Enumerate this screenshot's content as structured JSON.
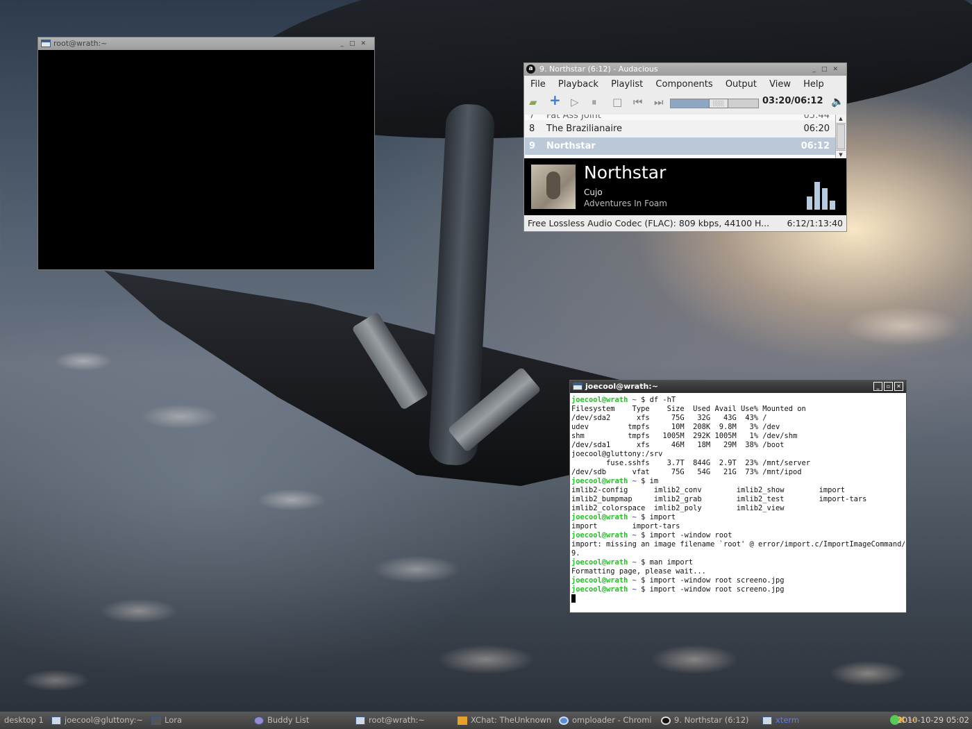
{
  "root_terminal": {
    "title": "root@wrath:~"
  },
  "audacious": {
    "title": "9. Northstar (6:12) - Audacious",
    "logo": "a",
    "menu": [
      "File",
      "Playback",
      "Playlist",
      "Components",
      "Output",
      "View",
      "Help"
    ],
    "time": "03:20/06:12",
    "seek_fraction": 0.54,
    "playlist": [
      {
        "num": "7",
        "title": "Fat Ass Joint",
        "duration": "05:44",
        "cut": true
      },
      {
        "num": "8",
        "title": "The Brazilianaire",
        "duration": "06:20"
      },
      {
        "num": "9",
        "title": "Northstar",
        "duration": "06:12",
        "selected": true
      }
    ],
    "now_playing": {
      "title": "Northstar",
      "artist": "Cujo",
      "album": "Adventures In Foam"
    },
    "visualizer_levels": [
      0.45,
      0.95,
      0.75,
      0.3
    ],
    "codec": "Free Lossless Audio Codec (FLAC): 809 kbps, 44100 H...",
    "total": "6:12/1:13:40",
    "accent_color": "#bac8d8"
  },
  "xterm": {
    "title": "joecool@wrath:~",
    "lines": [
      {
        "prompt": "joecool@wrath",
        "tilde": " ~ ",
        "cmd": "$ df -hT"
      },
      {
        "text": "Filesystem    Type    Size  Used Avail Use% Mounted on"
      },
      {
        "text": "/dev/sda2      xfs     75G   32G   43G  43% /"
      },
      {
        "text": "udev         tmpfs     10M  208K  9.8M   3% /dev"
      },
      {
        "text": "shm          tmpfs   1005M  292K 1005M   1% /dev/shm"
      },
      {
        "text": "/dev/sda1      xfs     46M   18M   29M  38% /boot"
      },
      {
        "text": "joecool@gluttony:/srv"
      },
      {
        "text": "        fuse.sshfs    3.7T  844G  2.9T  23% /mnt/server"
      },
      {
        "text": "/dev/sdb      vfat     75G   54G   21G  73% /mnt/ipod"
      },
      {
        "prompt": "joecool@wrath",
        "tilde": " ~ ",
        "cmd": "$ im"
      },
      {
        "text": "imlib2-config      imlib2_conv        imlib2_show        import"
      },
      {
        "text": "imlib2_bumpmap     imlib2_grab        imlib2_test        import-tars"
      },
      {
        "text": "imlib2_colorspace  imlib2_poly        imlib2_view"
      },
      {
        "prompt": "joecool@wrath",
        "tilde": " ~ ",
        "cmd": "$ import"
      },
      {
        "text": "import        import-tars"
      },
      {
        "prompt": "joecool@wrath",
        "tilde": " ~ ",
        "cmd": "$ import -window root"
      },
      {
        "text": "import: missing an image filename `root' @ error/import.c/ImportImageCommand/128"
      },
      {
        "text": "9."
      },
      {
        "prompt": "joecool@wrath",
        "tilde": " ~ ",
        "cmd": "$ man import"
      },
      {
        "text": "Formatting page, please wait..."
      },
      {
        "prompt": "joecool@wrath",
        "tilde": " ~ ",
        "cmd": "$ import -window root screeno.jpg"
      },
      {
        "prompt": "joecool@wrath",
        "tilde": " ~ ",
        "cmd": "$ import -window root screeno.jpg"
      }
    ],
    "prompt_color": "#22c022"
  },
  "taskbar": {
    "desktop": "desktop 1",
    "tasks": [
      {
        "label": "joecool@gluttony:~",
        "icon": "terminal-icon"
      },
      {
        "label": "Lora",
        "icon": "avatar-icon"
      },
      {
        "label": "Buddy List",
        "icon": "pidgin-icon"
      },
      {
        "label": "root@wrath:~",
        "icon": "terminal-icon"
      },
      {
        "label": "XChat: TheUnknown",
        "icon": "xchat-icon"
      },
      {
        "label": "omploader - Chromi",
        "icon": "chromium-icon"
      },
      {
        "label": "9. Northstar (6:12)",
        "icon": "audacious-icon"
      },
      {
        "label": "xterm",
        "icon": "terminal-icon",
        "active": true
      }
    ],
    "clock": "2010-10-29 05:02",
    "tray_chat_label": "chat"
  }
}
